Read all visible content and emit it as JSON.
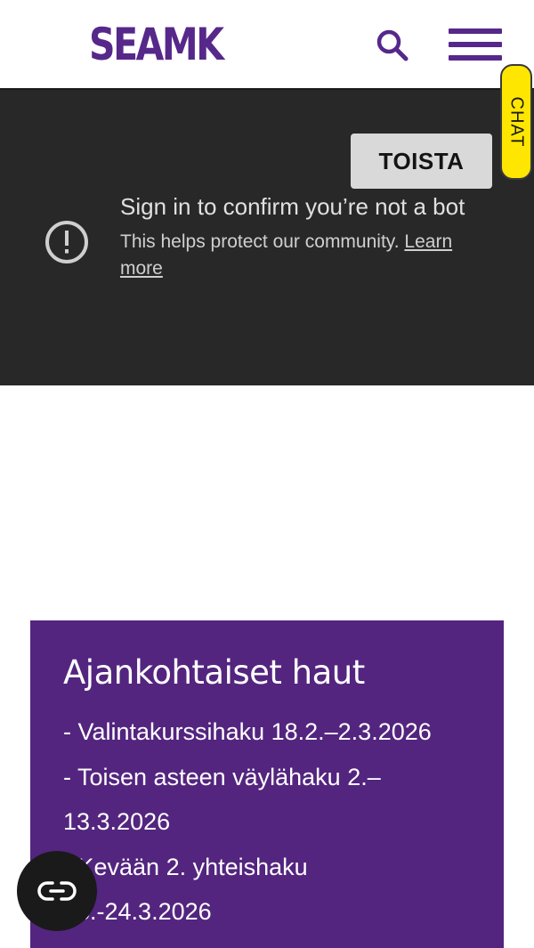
{
  "header": {
    "logo_text": "SEAMK",
    "search_icon": "search-icon",
    "menu_icon": "hamburger-menu-icon",
    "brand_color": "#56288a"
  },
  "chat": {
    "label": "CHAT",
    "color": "#ffe600"
  },
  "video": {
    "replay_label": "TOISTA",
    "alert_icon": "alert-circle-icon",
    "title": "Sign in to confirm you’re not a bot",
    "message": "This helps protect our community.",
    "learn_more": "Learn more"
  },
  "applications": {
    "title": "Ajankohtaiset haut",
    "items": [
      "- Valintakurssihaku 18.2.–2.3.2026",
      "- Toisen asteen väylähaku 2.–",
      "13.3.2026",
      "- Kevään 2. yhteishaku",
      "18.-24.3.2026"
    ],
    "background_color": "#53257f"
  },
  "accessibility": {
    "icon": "accessibility-cc-icon"
  }
}
